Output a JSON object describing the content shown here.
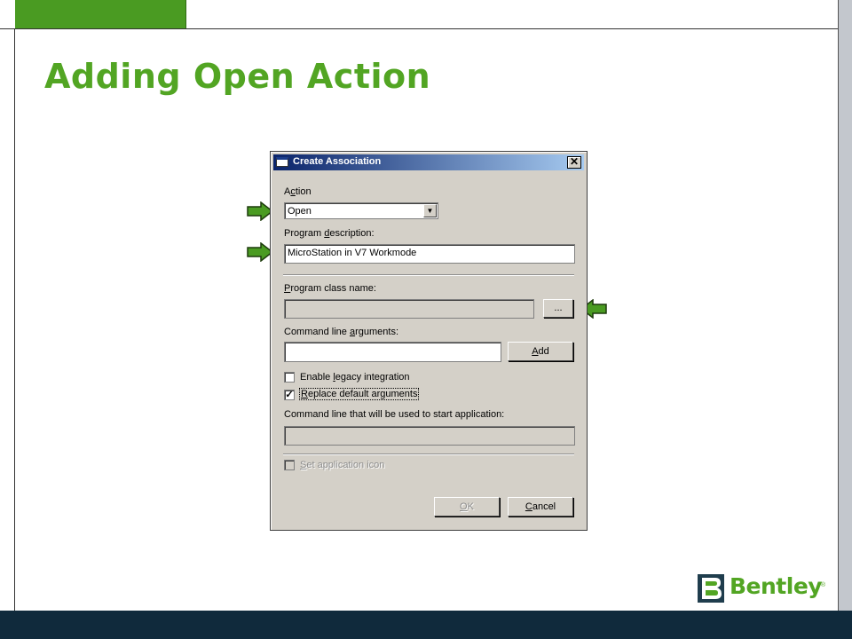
{
  "slide": {
    "title": "Adding Open Action",
    "brand": "Bentley",
    "brand_mark": "®",
    "accent_color": "#52a523",
    "footer_color": "#102a3c"
  },
  "dialog": {
    "title": "Create Association",
    "close_glyph": "✕",
    "action_label_pre": "A",
    "action_label_u": "c",
    "action_label_post": "tion",
    "action_value": "Open",
    "program_desc_label_pre": "Program ",
    "program_desc_label_u": "d",
    "program_desc_label_post": "escription:",
    "program_desc_value": "MicroStation in V7 Workmode",
    "program_class_label_pre": "",
    "program_class_label_u": "P",
    "program_class_label_post": "rogram class name:",
    "program_class_value": "",
    "browse_label": "...",
    "cmd_args_label_pre": "Command line ",
    "cmd_args_label_u": "a",
    "cmd_args_label_post": "rguments:",
    "cmd_args_value": "",
    "add_label_u": "A",
    "add_label_post": "dd",
    "legacy_label_pre": "Enable ",
    "legacy_label_u": "l",
    "legacy_label_post": "egacy integration",
    "legacy_checked": false,
    "replace_label_pre": "",
    "replace_label_u": "R",
    "replace_label_post": "eplace default arguments",
    "replace_checked": true,
    "check_glyph": "✓",
    "cmdline_label": "Command line that will be used to start application:",
    "cmdline_value": "",
    "icon_label_pre": "",
    "icon_label_u": "S",
    "icon_label_post": "et application icon",
    "icon_checked": false,
    "ok_label_u": "O",
    "ok_label_post": "K",
    "cancel_label_pre": "",
    "cancel_label_u": "C",
    "cancel_label_post": "ancel"
  }
}
